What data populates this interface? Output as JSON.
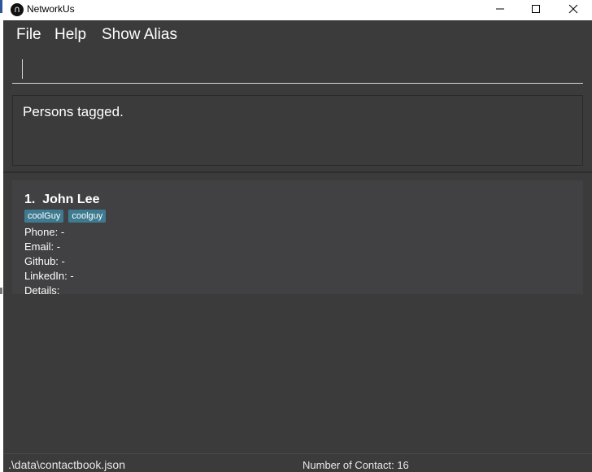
{
  "window": {
    "title": "NetworkUs",
    "icon": "app-logo-icon",
    "controls": [
      "minimize-icon",
      "maximize-icon",
      "close-icon"
    ]
  },
  "menu": {
    "items": [
      {
        "label": "File"
      },
      {
        "label": "Help"
      },
      {
        "label": "Show Alias"
      }
    ]
  },
  "command": {
    "value": ""
  },
  "result": {
    "message": "Persons tagged."
  },
  "contacts": [
    {
      "index": "1.",
      "name": "John Lee",
      "tags": [
        "coolGuy",
        "coolguy"
      ],
      "phone": "Phone: -",
      "email": "Email: -",
      "github": "Github: -",
      "linkedin": "LinkedIn: -",
      "details": "Details:"
    }
  ],
  "status": {
    "file_path": ".\\data\\contactbook.json",
    "contact_count": "Number of Contact: 16"
  },
  "colors": {
    "background": "#3b3b3c",
    "card": "#414143",
    "tag": "#3e7b91",
    "text": "#ffffff"
  }
}
